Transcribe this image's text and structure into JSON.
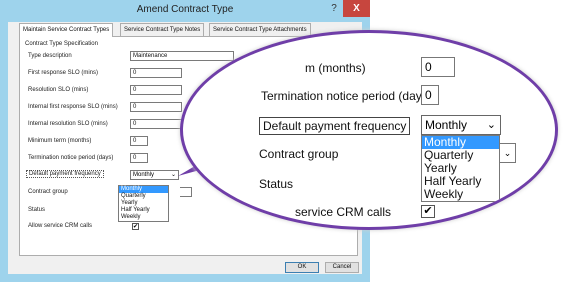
{
  "window": {
    "title": "Amend Contract Type",
    "help_label": "?",
    "close_label": "X"
  },
  "tabs": [
    {
      "label": "Maintain Service Contract Types"
    },
    {
      "label": "Service Contract Type Notes"
    },
    {
      "label": "Service Contract Type Attachments"
    }
  ],
  "spec": {
    "group_label": "Contract Type Specification",
    "fields": [
      {
        "label": "Type description",
        "value": "Maintenance"
      },
      {
        "label": "First response SLO (mins)",
        "value": "0"
      },
      {
        "label": "Resolution SLO (mins)",
        "value": "0"
      },
      {
        "label": "Internal first response SLO (mins)",
        "value": "0"
      },
      {
        "label": "Internal resolution SLO (mins)",
        "value": "0"
      },
      {
        "label": "Minimum term (months)",
        "value": "0"
      },
      {
        "label": "Termination notice period (days)",
        "value": "0"
      }
    ],
    "payment_label": "Default payment frequency",
    "payment_value": "Monthly",
    "payment_options": [
      "Monthly",
      "Quarterly",
      "Yearly",
      "Half Yearly",
      "Weekly"
    ],
    "group_field_label": "Contract group",
    "status_label": "Status",
    "allow_crm_label": "Allow service CRM calls",
    "allow_crm_checked": true
  },
  "buttons": {
    "ok": "OK",
    "cancel": "Cancel"
  },
  "zoom": {
    "min_term_partial": "m (months)",
    "min_term_value": "0",
    "termination_label": "Termination notice period (days)",
    "termination_value": "0",
    "payment_label": "Default payment frequency",
    "payment_value": "Monthly",
    "payment_options": [
      "Monthly",
      "Quarterly",
      "Yearly",
      "Half Yearly",
      "Weekly"
    ],
    "group_label": "Contract group",
    "status_label": "Status",
    "allow_crm_partial": "service CRM calls",
    "check_mark": "✔",
    "arrow": "⌄"
  },
  "colors": {
    "window_frame": "#9ed3ec",
    "close_button": "#c7463e",
    "selection": "#3399ff",
    "callout": "#6f3ea8"
  }
}
